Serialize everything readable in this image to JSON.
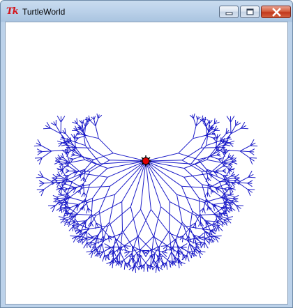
{
  "window": {
    "title": "TurtleWorld",
    "app_icon_text": "Tk"
  },
  "controls": {
    "minimize": "minimize",
    "maximize": "maximize",
    "close": "close"
  },
  "colors": {
    "line": "#1a1ac8",
    "turtle_body": "#e00000",
    "turtle_outline": "#000000",
    "canvas_bg": "#ffffff"
  }
}
